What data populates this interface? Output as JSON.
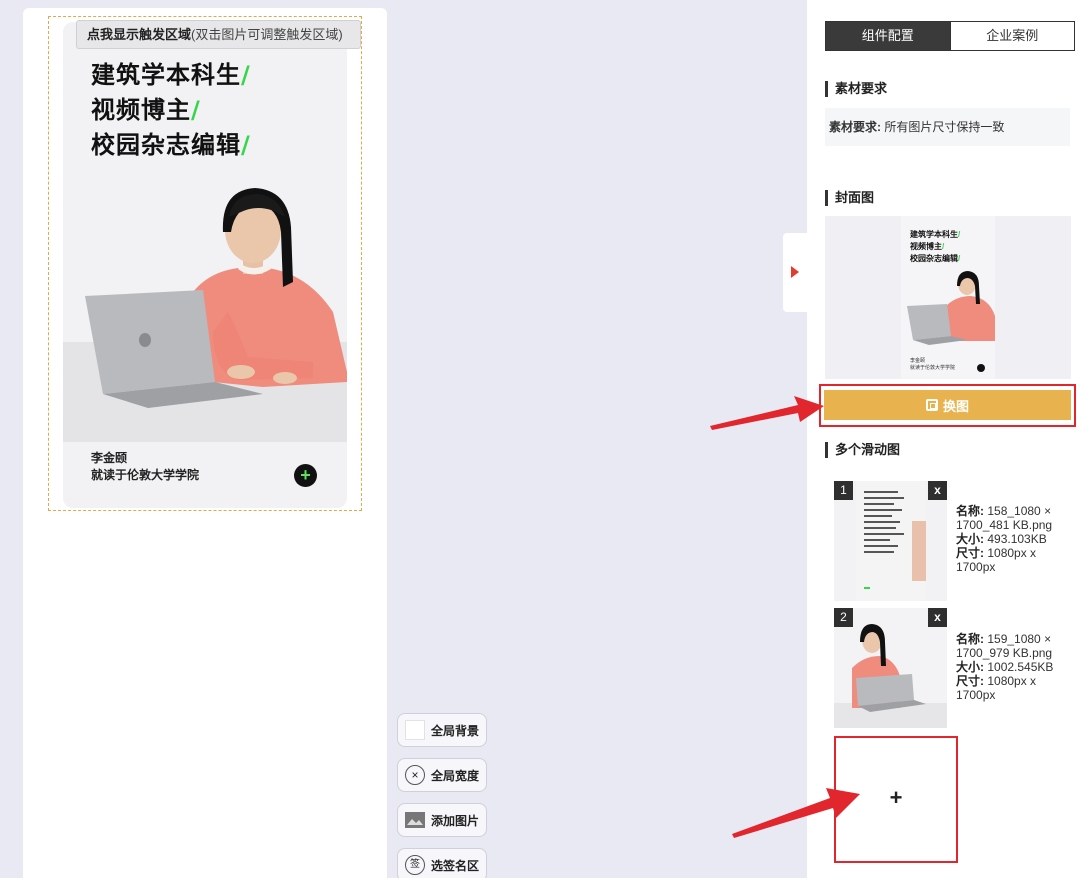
{
  "canvas": {
    "trigger_tip_bold": "点我显示触发区域",
    "trigger_tip_sub": "(双击图片可调整触发区域)",
    "headline_lines": [
      "建筑学本科生",
      "视频博主",
      "校园杂志编辑"
    ],
    "slash": "/",
    "caption_name": "李金颐",
    "caption_school": "就读于伦敦大学学院",
    "plus_glyph": "+"
  },
  "tools": [
    {
      "label": "全局背景",
      "icon": "white-square-icon"
    },
    {
      "label": "全局宽度",
      "icon": "close-circle-icon"
    },
    {
      "label": "添加图片",
      "icon": "image-icon"
    },
    {
      "label": "选签名区",
      "icon": "sign-icon"
    }
  ],
  "panel": {
    "tabs": [
      "组件配置",
      "企业案例"
    ],
    "active_tab": 0,
    "sections": {
      "material": "素材要求",
      "cover": "封面图",
      "slides": "多个滑动图"
    },
    "material_label": "素材要求:",
    "material_text": "所有图片尺寸保持一致",
    "swap_label": "换图",
    "slides": [
      {
        "index": "1",
        "name_label": "名称:",
        "name": "158_1080 × 1700_481 KB.png",
        "size_label": "大小:",
        "size": "493.103KB",
        "dim_label": "尺寸:",
        "dims": "1080px x 1700px"
      },
      {
        "index": "2",
        "name_label": "名称:",
        "name": "159_1080 × 1700_979 KB.png",
        "size_label": "大小:",
        "size": "1002.545KB",
        "dim_label": "尺寸:",
        "dims": "1080px x 1700px"
      }
    ],
    "close_glyph": "x",
    "add_glyph": "+",
    "sign_glyph": "签",
    "circle_x_glyph": "×"
  },
  "colors": {
    "accent_yellow": "#e8b34f",
    "highlight_red": "#e1262e",
    "slash_green": "#37d64a"
  }
}
